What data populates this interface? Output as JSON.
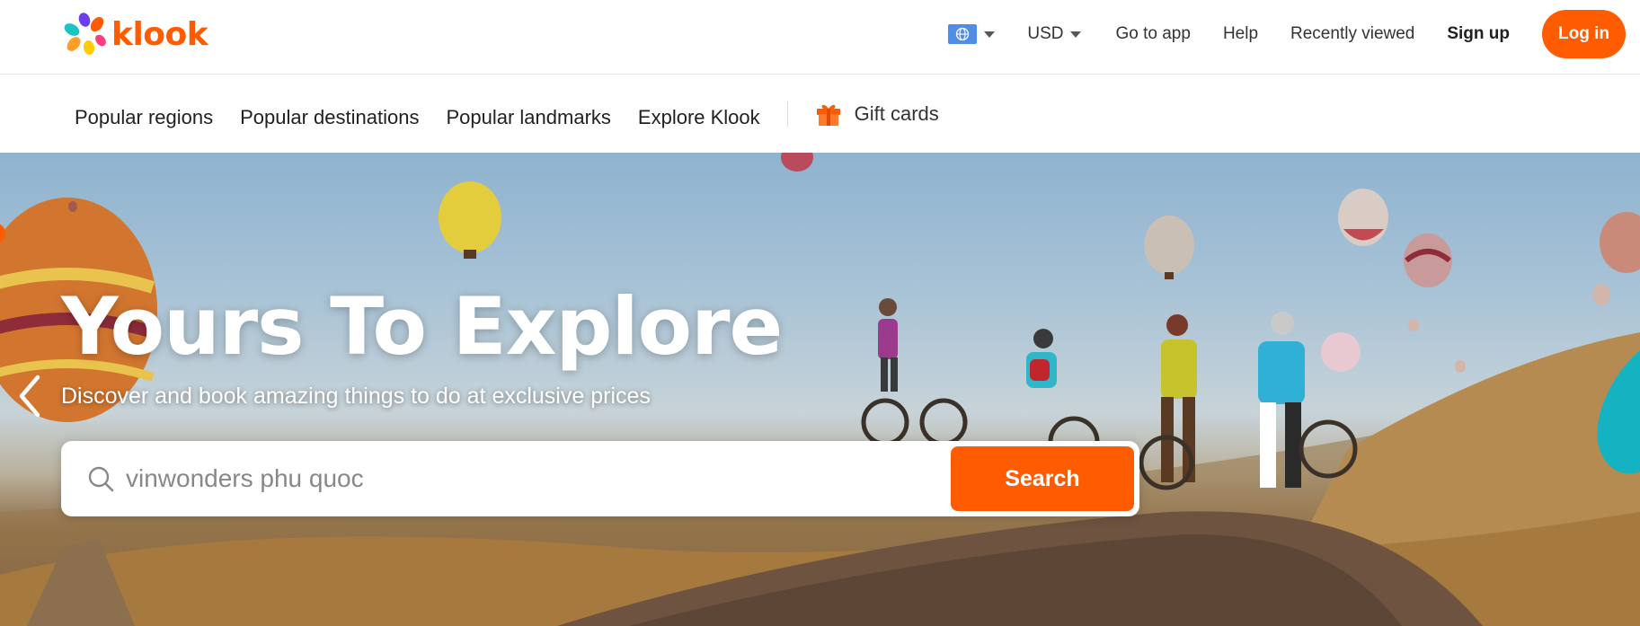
{
  "brand": {
    "name": "klook",
    "color": "#ff5b00"
  },
  "header": {
    "language_icon": "globe-icon",
    "currency": "USD",
    "links": {
      "go_to_app": "Go to app",
      "help": "Help",
      "recently_viewed": "Recently viewed",
      "sign_up": "Sign up"
    },
    "login_label": "Log in"
  },
  "subnav": {
    "items": [
      "Popular regions",
      "Popular destinations",
      "Popular landmarks",
      "Explore Klook"
    ],
    "gift_cards": "Gift cards"
  },
  "hero": {
    "title": "Yours To Explore",
    "subtitle": "Discover and book amazing things to do at exclusive prices",
    "prev_icon": "chevron-left-icon"
  },
  "search": {
    "placeholder": "vinwonders phu quoc",
    "button_label": "Search"
  }
}
